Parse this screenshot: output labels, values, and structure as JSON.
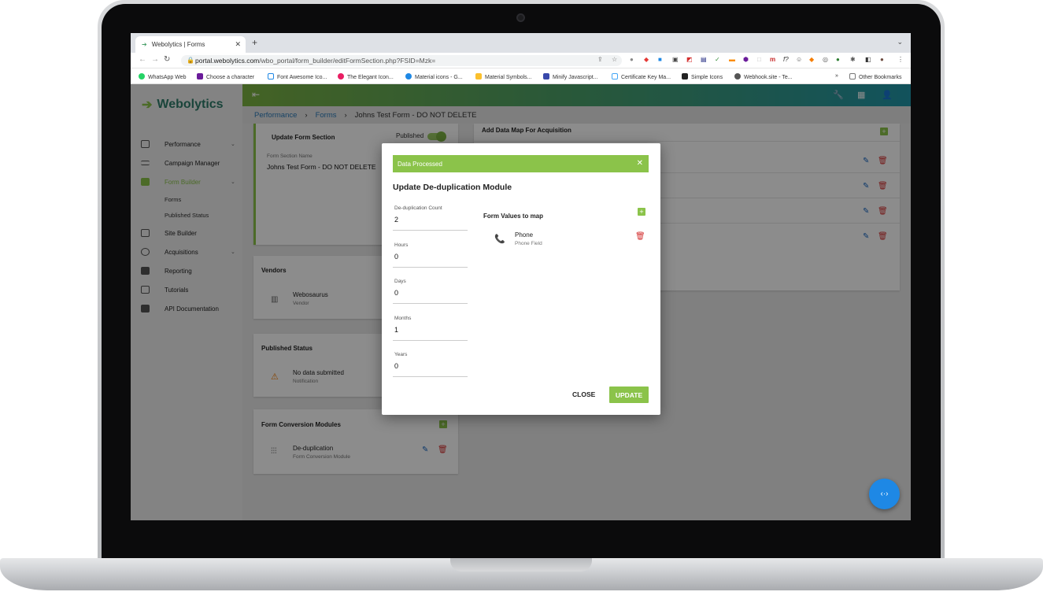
{
  "browser": {
    "tab_title": "Webolytics | Forms",
    "url_domain": "portal.webolytics.com",
    "url_path": "/wbo_portal/form_builder/editFormSection.php?FSID=Mzk=",
    "bookmarks": [
      "WhatsApp Web",
      "Choose a character",
      "Font Awesome Ico...",
      "The Elegant Icon...",
      "Material icons - G...",
      "Material Symbols...",
      "Minify Javascript...",
      "Certificate Key Ma...",
      "Simple Icons",
      "Webhook.site - Te..."
    ],
    "bookmarks_more": "»",
    "other_bookmarks": "Other Bookmarks"
  },
  "app": {
    "logo": "Webolytics",
    "nav": [
      {
        "label": "Performance",
        "chevron": true
      },
      {
        "label": "Campaign Manager",
        "chevron": false
      },
      {
        "label": "Form Builder",
        "chevron": true,
        "active": true
      },
      {
        "label": "Site Builder",
        "chevron": false
      },
      {
        "label": "Acquisitions",
        "chevron": true
      },
      {
        "label": "Reporting",
        "chevron": false
      },
      {
        "label": "Tutorials",
        "chevron": false
      },
      {
        "label": "API Documentation",
        "chevron": false
      }
    ],
    "subnav": [
      "Forms",
      "Published Status"
    ]
  },
  "breadcrumb": {
    "items": [
      "Performance",
      "Forms",
      "Johns Test Form - DO NOT DELETE"
    ]
  },
  "page": {
    "update_section_title": "Update Form Section",
    "published_label": "Published",
    "section_name_label": "Form Section Name",
    "section_name_value": "Johns Test Form - DO NOT DELETE",
    "vendors_title": "Vendors",
    "vendor_name": "Webosaurus",
    "vendor_sub": "Vendor",
    "published_status_title": "Published Status",
    "status_text": "No data submitted",
    "status_sub": "Notification",
    "fcm_title": "Form Conversion Modules",
    "module_name": "De-duplication",
    "module_sub": "Form Conversion Module",
    "data_map_title": "Add Data Map For Acquisition"
  },
  "modal": {
    "banner": "Data Processed",
    "title": "Update De-duplication Module",
    "fields": [
      {
        "label": "De-duplication Count",
        "value": "2"
      },
      {
        "label": "Hours",
        "value": "0"
      },
      {
        "label": "Days",
        "value": "0"
      },
      {
        "label": "Months",
        "value": "1"
      },
      {
        "label": "Years",
        "value": "0"
      }
    ],
    "map_title": "Form Values to map",
    "map_item_label": "Phone",
    "map_item_sub": "Phone Field",
    "close_label": "CLOSE",
    "update_label": "UPDATE"
  },
  "colors": {
    "accent": "#8bc34a",
    "brand": "#2f7d6b",
    "edit": "#1565c0",
    "delete": "#d32f2f",
    "fab": "#1e88e5"
  }
}
